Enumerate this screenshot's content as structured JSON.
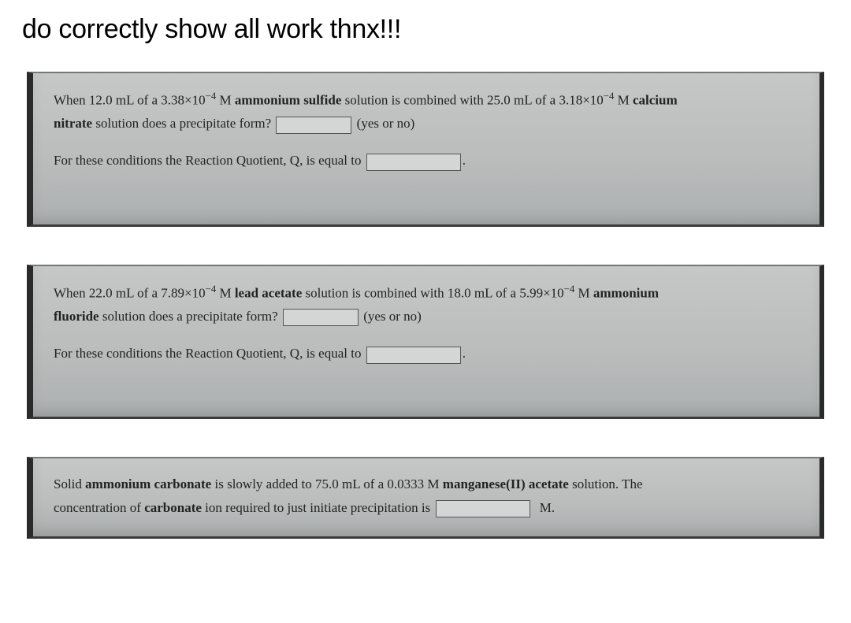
{
  "title": "do correctly show all work thnx!!!",
  "q1": {
    "part1a": "When 12.0 mL of a 3.38×10",
    "exp1": "−4",
    "part1b": " M ",
    "chem1": "ammonium sulfide",
    "part1c": " solution is combined with 25.0 mL of a 3.18×10",
    "exp2": "−4",
    "part1d": " M ",
    "chem2": "calcium",
    "part2a": "nitrate",
    "part2b": " solution does a precipitate form?",
    "yesno": "(yes or no)",
    "rq": "For these conditions the Reaction Quotient, Q, is equal to"
  },
  "q2": {
    "part1a": "When 22.0 mL of a 7.89×10",
    "exp1": "−4",
    "part1b": " M ",
    "chem1": "lead acetate",
    "part1c": " solution is combined with 18.0 mL of a 5.99×10",
    "exp2": "−4",
    "part1d": " M ",
    "chem2": "ammonium",
    "part2a": "fluoride",
    "part2b": " solution does a precipitate form?",
    "yesno": "(yes or no)",
    "rq": "For these conditions the Reaction Quotient, Q, is equal to"
  },
  "q3": {
    "part1a": "Solid ",
    "chem1": "ammonium carbonate",
    "part1b": " is slowly added to 75.0 mL of a 0.0333 M ",
    "chem2": "manganese(II) acetate",
    "part1c": " solution. The",
    "part2a": "concentration of ",
    "ion": "carbonate",
    "part2b": " ion required to just initiate precipitation is",
    "unit": "M."
  }
}
